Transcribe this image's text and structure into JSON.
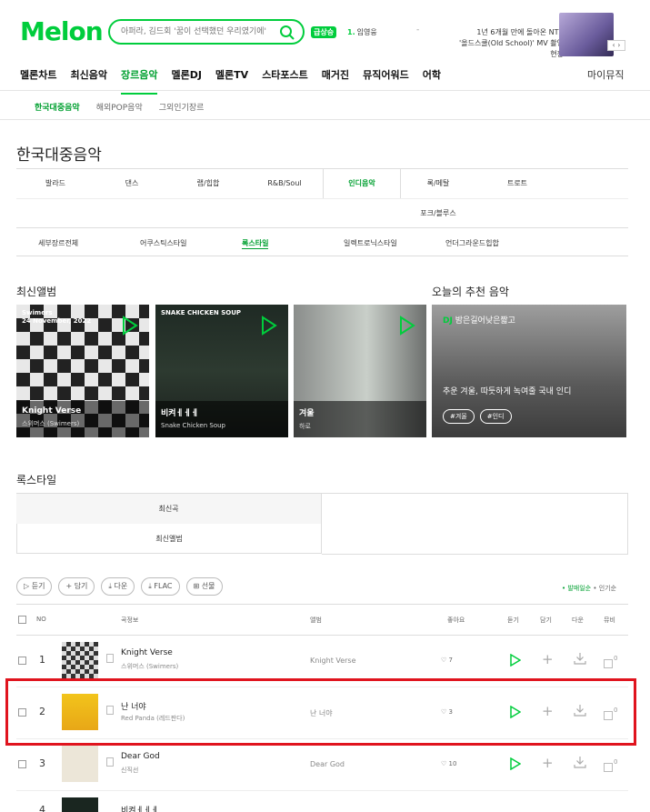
{
  "header": {
    "logo": "Melon",
    "search_placeholder": "아퍼라, 김드회 '꿈이 선택했던 우리였기에'",
    "rise_badge": "급상승",
    "rank_no": "1.",
    "rank_text": "임영웅",
    "dash": "-",
    "promo_line1": "1년 6개월 만에 돌아온 NTX",
    "promo_line2": "'올드스쿨(Old School)' MV 촬영 현장",
    "promo_arrows": "‹ ›"
  },
  "gnb": {
    "items": [
      "멜론차트",
      "최신음악",
      "장르음악",
      "멜론DJ",
      "멜론TV",
      "스타포스트",
      "매거진",
      "뮤직어워드",
      "어학"
    ],
    "mymusic": "마이뮤직"
  },
  "subnav": [
    "한국대중음악",
    "해외POP음악",
    "그외인기장르"
  ],
  "page_title": "한국대중음악",
  "genres": [
    "발라드",
    "댄스",
    "랩/힙합",
    "R&B/Soul",
    "인디음악",
    "록/메탈",
    "트로트",
    "포크/블루스"
  ],
  "styles": [
    "세부장르전체",
    "어쿠스틱스타일",
    "록스타일",
    "일렉트로닉스타일",
    "언더그라운드힙합"
  ],
  "new_albums": {
    "title": "최신앨범",
    "items": [
      {
        "title": "Knight Verse",
        "artist": "스위머스 (Swimers)",
        "top_line1": "Swimers",
        "top_line2": "24 November, 2022"
      },
      {
        "title": "비켜ㅔㅔㅔ",
        "artist": "Snake Chicken Soup",
        "top_line1": "SNAKE CHICKEN SOUP",
        "top_line2": ""
      },
      {
        "title": "겨울",
        "artist": "하로",
        "top_line1": "",
        "top_line2": ""
      }
    ]
  },
  "recommend": {
    "title": "오늘의 추천 음악",
    "dj": "DJ",
    "dj_name": "밤은길어낮은짧고",
    "text": "추운 겨울, 따듯하게 녹여줄 국내 인디",
    "tags": [
      "#겨울",
      "#인디"
    ]
  },
  "section_title": "록스타일",
  "tabs": [
    "최신곡",
    "최신앨범"
  ],
  "buttons": [
    "듣기",
    "담기",
    "다운",
    "FLAC",
    "선물"
  ],
  "sort": {
    "active": "발매일순",
    "other": "인기순"
  },
  "table_head": {
    "no": "NO",
    "song": "곡정보",
    "album": "앨범",
    "like": "좋아요",
    "listen": "듣기",
    "add": "담기",
    "down": "다운",
    "mv": "뮤비"
  },
  "rows": [
    {
      "no": "1",
      "title": "Knight Verse",
      "artist": "스위머스 (Swimers)",
      "album": "Knight Verse",
      "likes": "7",
      "mv": "0"
    },
    {
      "no": "2",
      "title": "난 너야",
      "artist": "Red Panda (레드판다)",
      "album": "난 너야",
      "likes": "3",
      "mv": "0"
    },
    {
      "no": "3",
      "title": "Dear God",
      "artist": "신직선",
      "album": "Dear God",
      "likes": "10",
      "mv": "0"
    },
    {
      "no": "4",
      "title": "비켜ㅔㅔㅔ",
      "artist": "",
      "album": "",
      "likes": "",
      "mv": ""
    }
  ]
}
